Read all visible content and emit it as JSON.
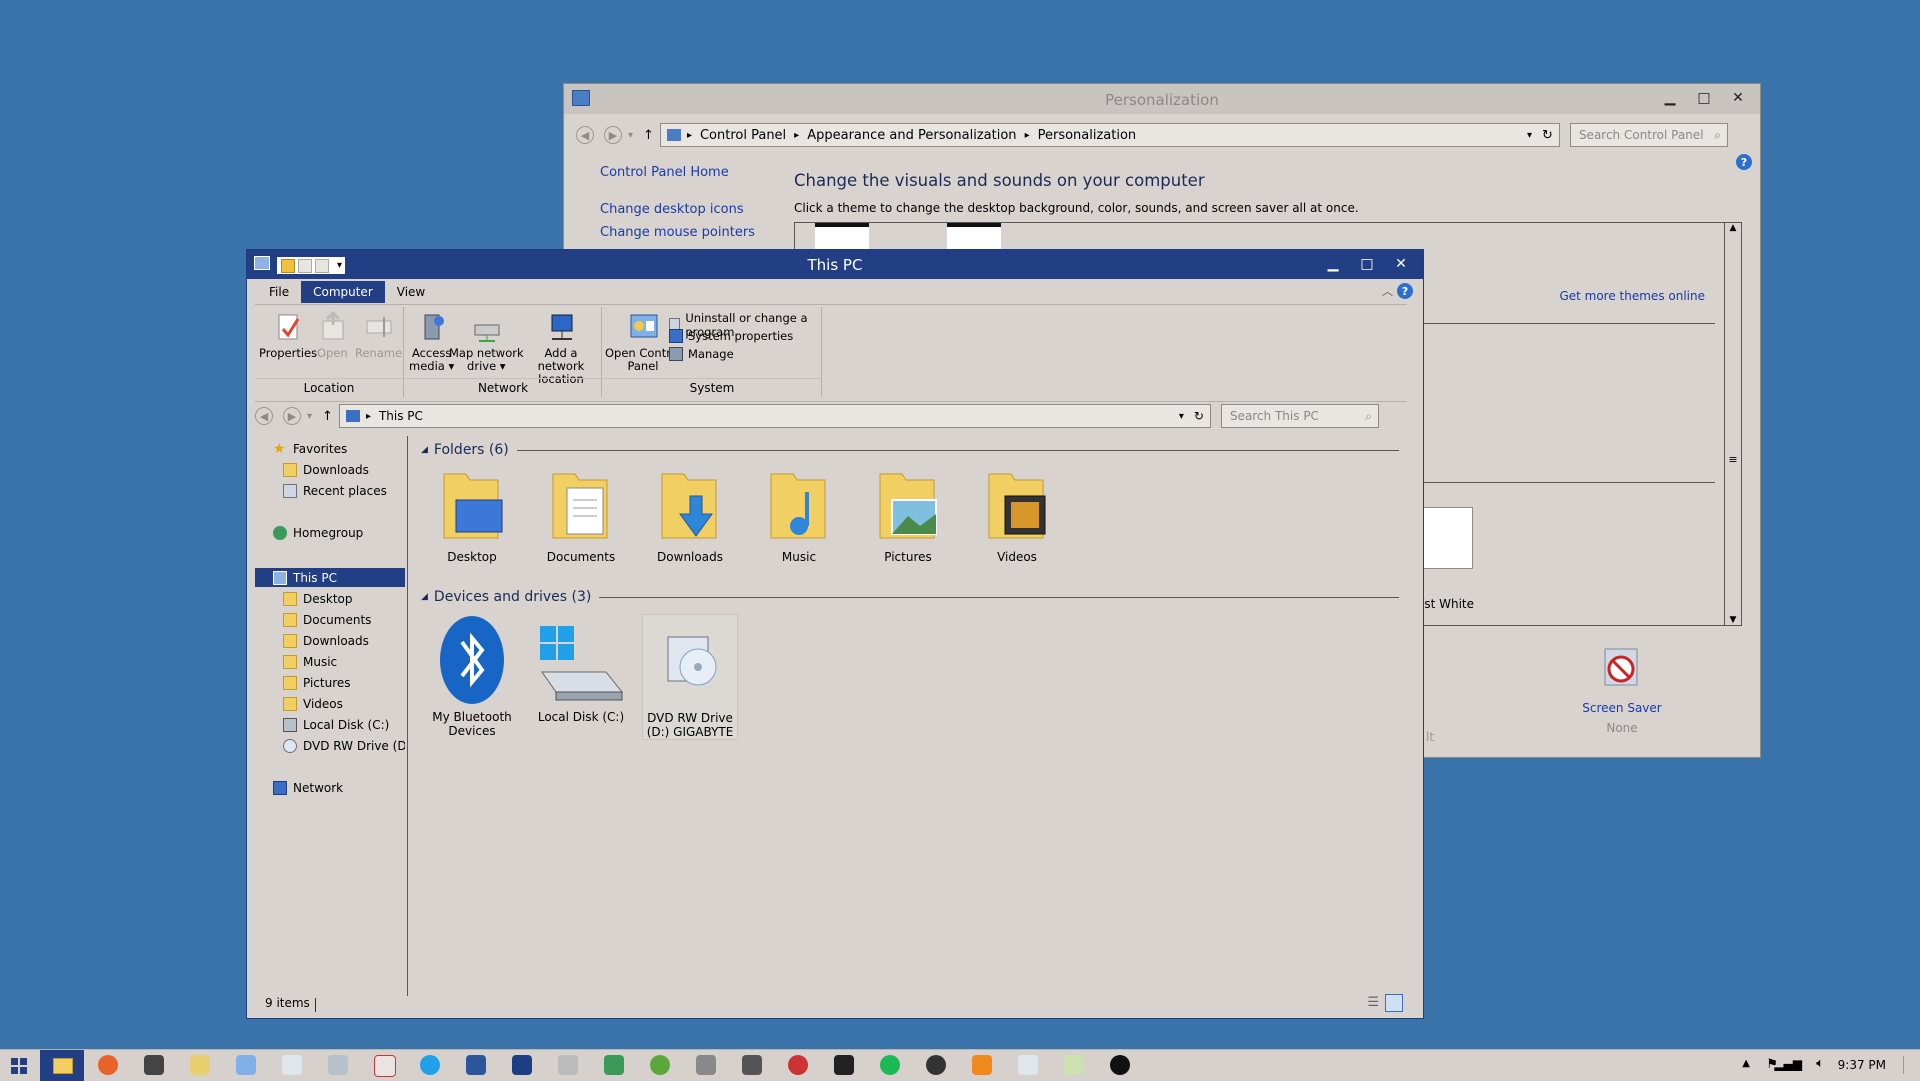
{
  "personalization": {
    "title": "Personalization",
    "breadcrumb": [
      "Control Panel",
      "Appearance and Personalization",
      "Personalization"
    ],
    "search_placeholder": "Search Control Panel",
    "sidebar_links": [
      "Control Panel Home",
      "Change desktop icons",
      "Change mouse pointers"
    ],
    "heading": "Change the visuals and sounds on your computer",
    "subheading": "Click a theme to change the desktop background, color, sounds, and screen saver all at once.",
    "more_themes_link": "Get more themes online",
    "theme_partial_label": "ast White",
    "partial_label_2": "lt",
    "screen_saver_label": "Screen Saver",
    "screen_saver_value": "None"
  },
  "thispc": {
    "title": "This PC",
    "tabs": [
      "File",
      "Computer",
      "View"
    ],
    "active_tab": "Computer",
    "ribbon": {
      "location": {
        "name": "Location",
        "buttons": [
          "Properties",
          "Open",
          "Rename"
        ]
      },
      "network": {
        "name": "Network",
        "buttons": [
          {
            "line1": "Access",
            "line2": "media ▾"
          },
          {
            "line1": "Map network",
            "line2": "drive ▾"
          },
          {
            "line1": "Add a network",
            "line2": "location"
          }
        ]
      },
      "system": {
        "name": "System",
        "open_cp_line1": "Open Control",
        "open_cp_line2": "Panel",
        "items": [
          "Uninstall or change a program",
          "System properties",
          "Manage"
        ]
      }
    },
    "address": "This PC",
    "search_placeholder": "Search This PC",
    "nav": {
      "favorites": "Favorites",
      "favorites_items": [
        "Downloads",
        "Recent places"
      ],
      "homegroup": "Homegroup",
      "thispc": "This PC",
      "thispc_items": [
        "Desktop",
        "Documents",
        "Downloads",
        "Music",
        "Pictures",
        "Videos",
        "Local Disk (C:)",
        "DVD RW Drive (D:) G"
      ],
      "network": "Network"
    },
    "folders_header": "Folders (6)",
    "folders": [
      "Desktop",
      "Documents",
      "Downloads",
      "Music",
      "Pictures",
      "Videos"
    ],
    "devices_header": "Devices and drives (3)",
    "devices": [
      {
        "line1": "My Bluetooth",
        "line2": "Devices"
      },
      {
        "line1": "Local Disk (C:)",
        "line2": ""
      },
      {
        "line1": "DVD RW Drive",
        "line2": "(D:) GIGABYTE"
      }
    ],
    "status": "9 items"
  },
  "taskbar": {
    "clock": "9:37 PM"
  },
  "colors": {
    "desktop": "#3a73aa",
    "active_titlebar": "#223f86",
    "window_bg": "#d8d3ce",
    "link": "#1a3aa8"
  }
}
